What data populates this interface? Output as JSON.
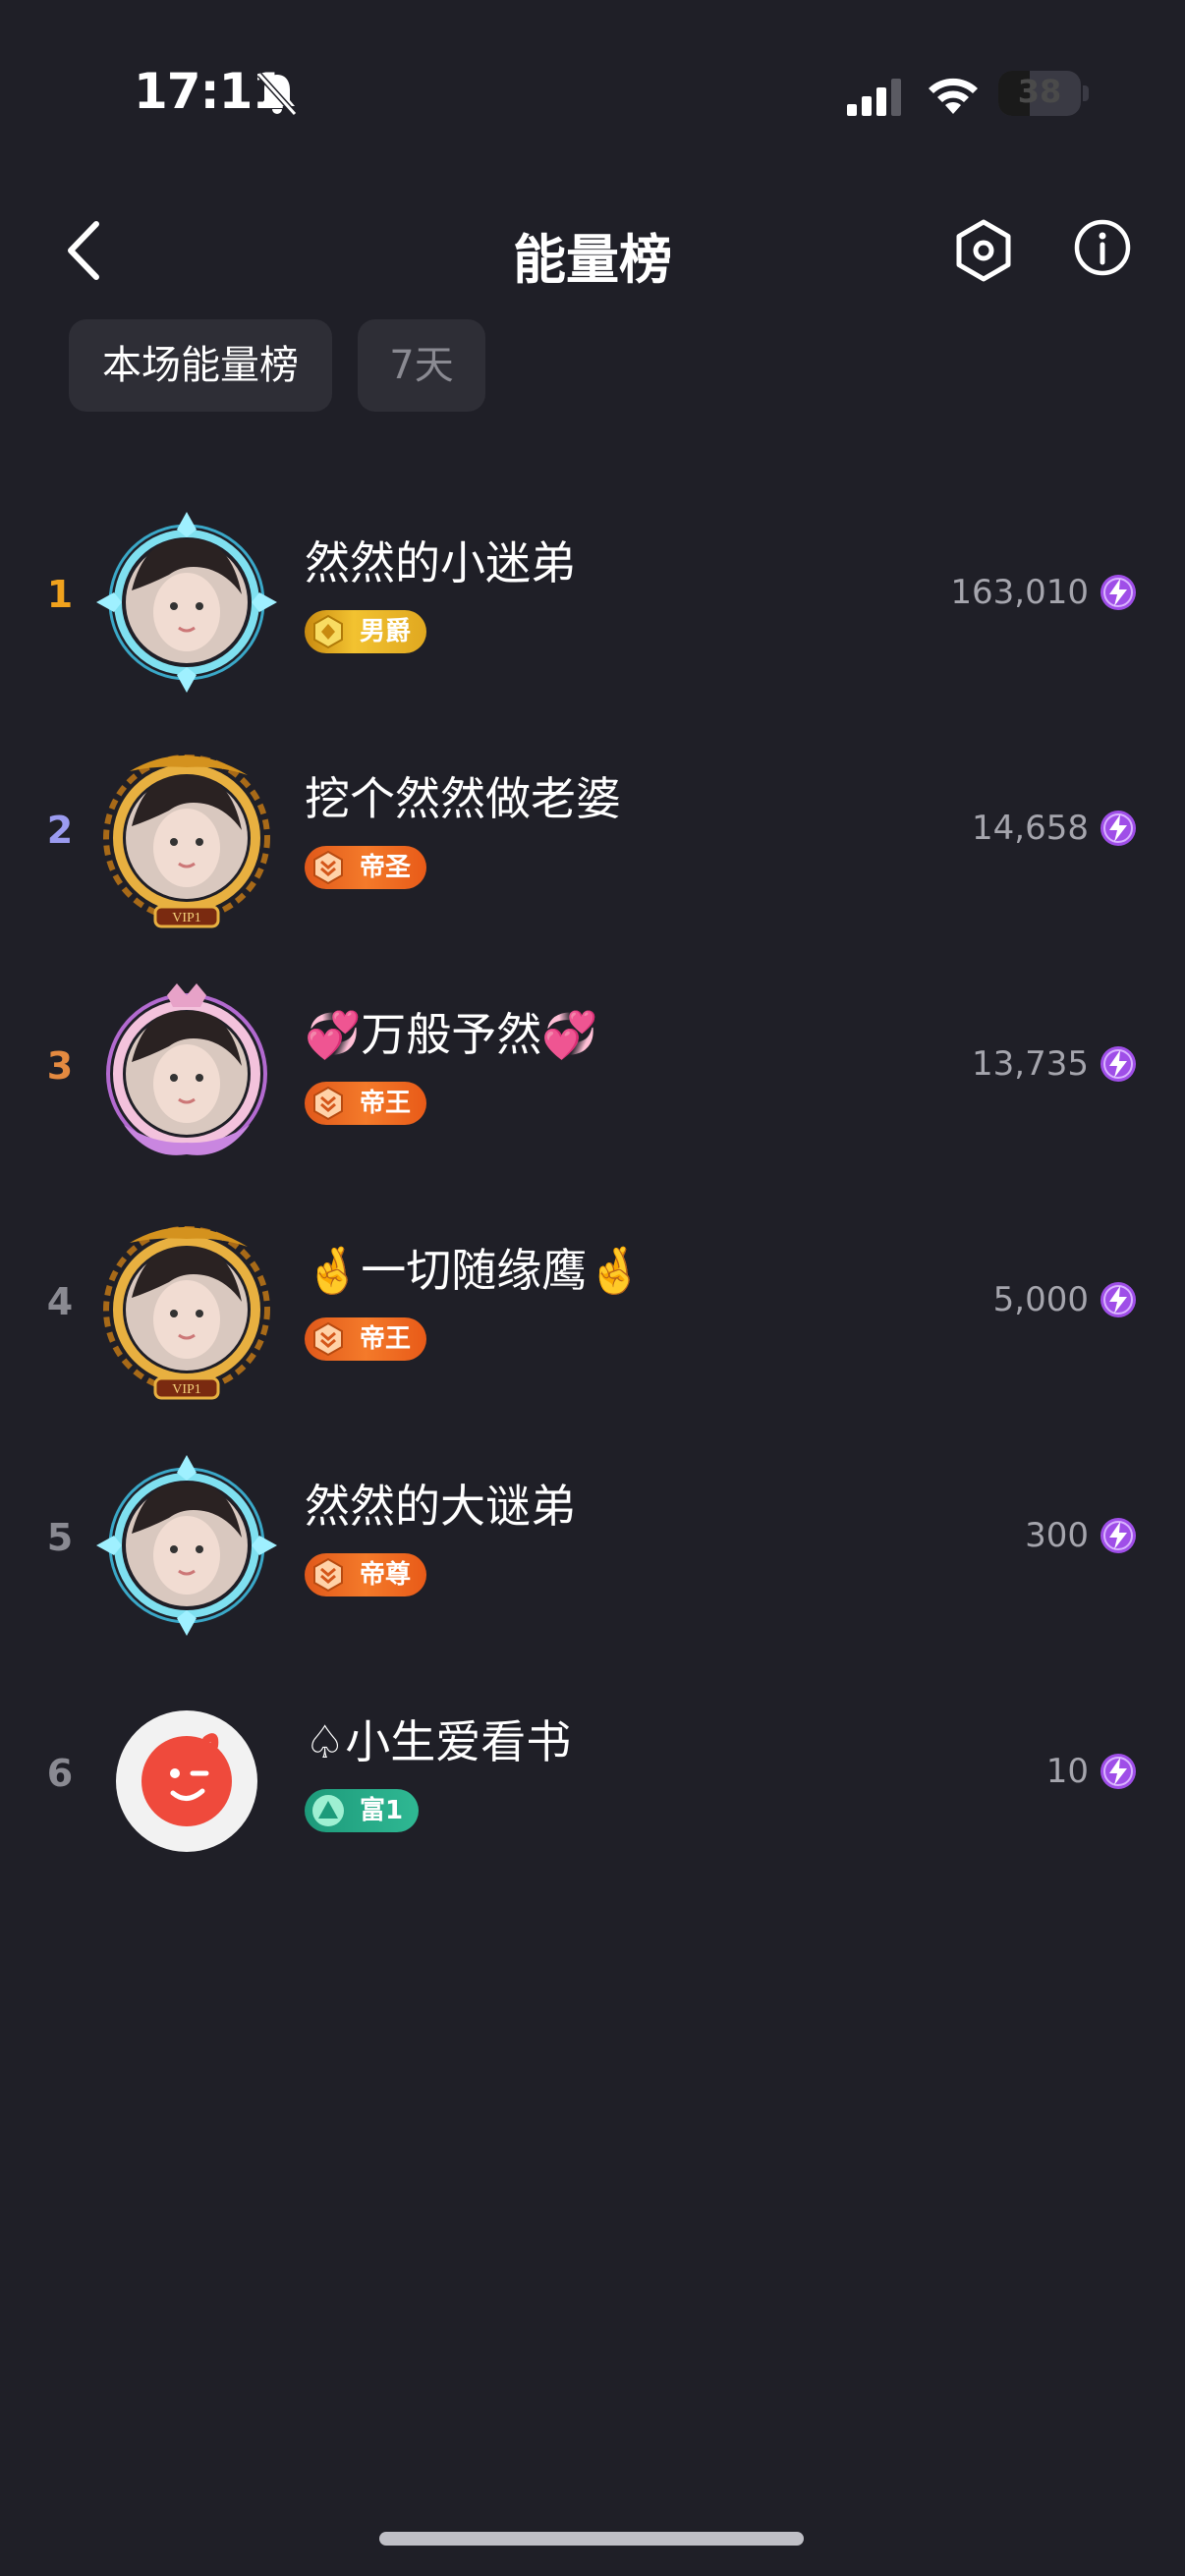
{
  "status_bar": {
    "time": "17:11",
    "battery": "38",
    "battery_level": 0.38,
    "icons": [
      "bell-off-icon",
      "signal-icon",
      "wifi-icon",
      "battery-icon"
    ]
  },
  "nav": {
    "title": "能量榜",
    "icons": [
      "back-chevron-icon",
      "settings-hex-icon",
      "info-icon"
    ]
  },
  "tabs": [
    {
      "label": "本场能量榜",
      "active": true
    },
    {
      "label": "7天",
      "active": false
    }
  ],
  "colors": {
    "background": "#1f1f27",
    "rank1": "#f0a21d",
    "rank2": "#9b9bf0",
    "rank3": "#e48a40",
    "rank_other": "#8a8a92",
    "energy_purple": "#9f4ee8"
  },
  "rankings": [
    {
      "rank": "1",
      "name": "然然的小迷弟",
      "badge": "男爵",
      "score": "163,010",
      "badge_style": "gold",
      "avatar_frame": "blue-crystal"
    },
    {
      "rank": "2",
      "name": "挖个然然做老婆",
      "badge": "帝圣",
      "score": "14,658",
      "badge_style": "orange",
      "avatar_frame": "gold-dragon"
    },
    {
      "rank": "3",
      "name": "💞万般予然💞",
      "badge": "帝王",
      "score": "13,735",
      "badge_style": "orange",
      "avatar_frame": "pink-crown"
    },
    {
      "rank": "4",
      "name": "🤞一切随缘鹰🤞",
      "badge": "帝王",
      "score": "5,000",
      "badge_style": "orange",
      "avatar_frame": "gold-dragon"
    },
    {
      "rank": "5",
      "name": "然然的大谜弟",
      "badge": "帝尊",
      "score": "300",
      "badge_style": "orange",
      "avatar_frame": "blue-crystal"
    },
    {
      "rank": "6",
      "name": "♤小生爱看书",
      "badge": "富1",
      "score": "10",
      "badge_style": "green",
      "avatar_frame": "default-red"
    }
  ]
}
